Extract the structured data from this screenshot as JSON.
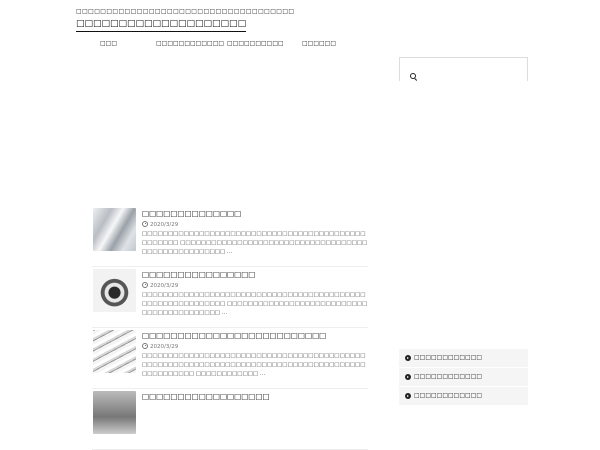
{
  "header": {
    "tagline": "□□□□□□□□□□□□□□□□□□□□□□□□□□□□□□□□□□□□",
    "site_title": "□□□□□□□□□□□□□□□□□□□□"
  },
  "nav": {
    "items": [
      {
        "label": "□□□"
      },
      {
        "label": "□□□□□□□□□□□□"
      },
      {
        "label": "□□□□□□□□□□"
      },
      {
        "label": "□□□□□□"
      }
    ]
  },
  "search": {
    "placeholder": "",
    "icon": "search-icon"
  },
  "posts": [
    {
      "title": "□□□□□□□□□□□□□□",
      "date": "2020/3/29",
      "excerpt": "□□□□□□□□□□□□□□□□□□□□□□□□□□□□□□□□□□□□□□□□□□□□□□□□□□ □□□□□□□□□□□□□□□□□□□□□□□□□□□□□□□□□□□□□□□□□□□□□□□□□□□□ …"
    },
    {
      "title": "□□□□□□□□□□□□□□□□",
      "date": "2020/3/29",
      "excerpt": "□□□□□□□□□□□□□□□□□□□□□□□□□□□□□□□□□□□□□□□□□□□□□□□□□□□□□□□□□□□ □□□□□□□□□□□□□□□□□□□□□□□□□□□□□□□□□□□□□□□□□□ …"
    },
    {
      "title": "□□□□□□□□□□□□□□□□□□□□□□□□□□",
      "date": "2020/3/29",
      "excerpt": "□□□□□□□□□□□□□□□□□□□□□□□□□□□□□□□□□□□□□□□□□□□□□□□□□□□□□□□□□□□□□□□□□□□□□□□□□□□□□□□□□□□□□□□□□□□□□□□□ □□□□□□□□□□□□ …"
    },
    {
      "title": "□□□□□□□□□□□□□□□□□□",
      "date": "",
      "excerpt": ""
    }
  ],
  "sidebar": {
    "items": [
      {
        "label": "□□□□□□□□□□□□"
      },
      {
        "label": "□□□□□□□□□□□□"
      },
      {
        "label": "□□□□□□□□□□□□"
      }
    ]
  }
}
